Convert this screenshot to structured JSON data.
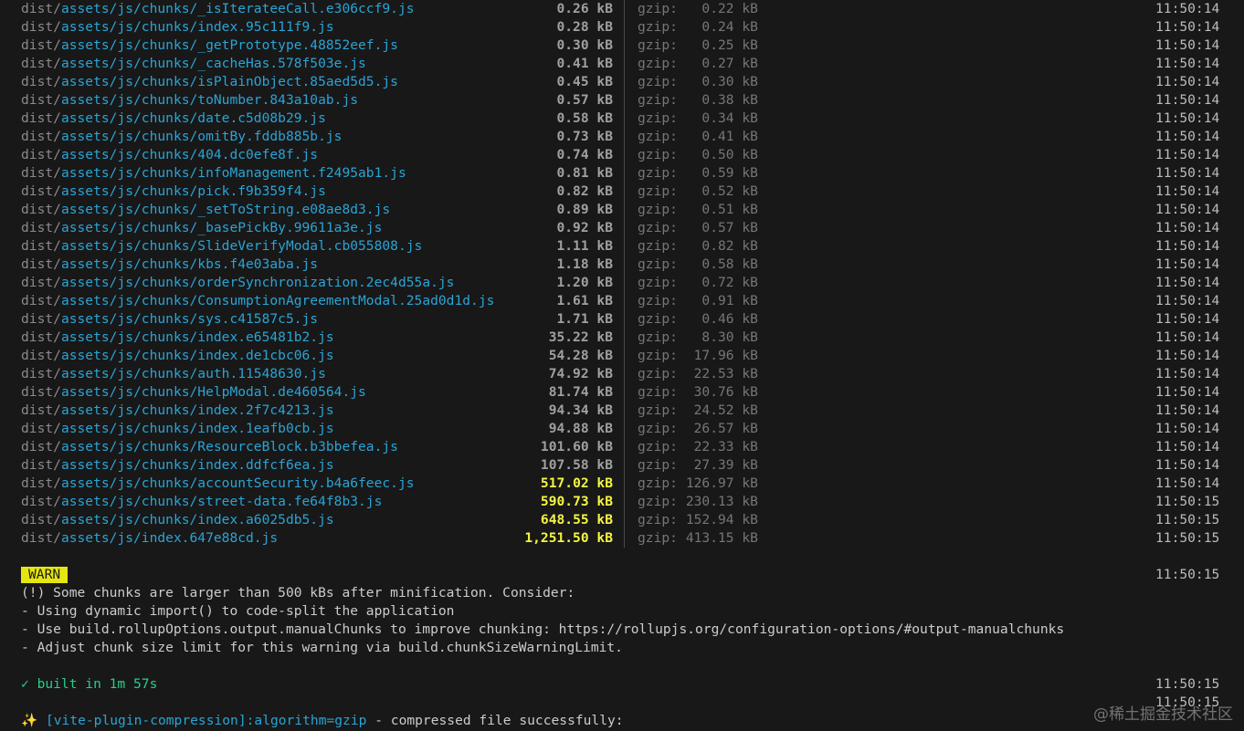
{
  "rows": [
    {
      "dir": "dist/",
      "file": "assets/js/chunks/_isIterateeCall.e306ccf9.js",
      "size": "0.26 kB",
      "gzip_label": "gzip:",
      "gzip": "0.22 kB",
      "time": "11:50:14",
      "large": false
    },
    {
      "dir": "dist/",
      "file": "assets/js/chunks/index.95c111f9.js",
      "size": "0.28 kB",
      "gzip_label": "gzip:",
      "gzip": "0.24 kB",
      "time": "11:50:14",
      "large": false
    },
    {
      "dir": "dist/",
      "file": "assets/js/chunks/_getPrototype.48852eef.js",
      "size": "0.30 kB",
      "gzip_label": "gzip:",
      "gzip": "0.25 kB",
      "time": "11:50:14",
      "large": false
    },
    {
      "dir": "dist/",
      "file": "assets/js/chunks/_cacheHas.578f503e.js",
      "size": "0.41 kB",
      "gzip_label": "gzip:",
      "gzip": "0.27 kB",
      "time": "11:50:14",
      "large": false
    },
    {
      "dir": "dist/",
      "file": "assets/js/chunks/isPlainObject.85aed5d5.js",
      "size": "0.45 kB",
      "gzip_label": "gzip:",
      "gzip": "0.30 kB",
      "time": "11:50:14",
      "large": false
    },
    {
      "dir": "dist/",
      "file": "assets/js/chunks/toNumber.843a10ab.js",
      "size": "0.57 kB",
      "gzip_label": "gzip:",
      "gzip": "0.38 kB",
      "time": "11:50:14",
      "large": false
    },
    {
      "dir": "dist/",
      "file": "assets/js/chunks/date.c5d08b29.js",
      "size": "0.58 kB",
      "gzip_label": "gzip:",
      "gzip": "0.34 kB",
      "time": "11:50:14",
      "large": false
    },
    {
      "dir": "dist/",
      "file": "assets/js/chunks/omitBy.fddb885b.js",
      "size": "0.73 kB",
      "gzip_label": "gzip:",
      "gzip": "0.41 kB",
      "time": "11:50:14",
      "large": false
    },
    {
      "dir": "dist/",
      "file": "assets/js/chunks/404.dc0efe8f.js",
      "size": "0.74 kB",
      "gzip_label": "gzip:",
      "gzip": "0.50 kB",
      "time": "11:50:14",
      "large": false
    },
    {
      "dir": "dist/",
      "file": "assets/js/chunks/infoManagement.f2495ab1.js",
      "size": "0.81 kB",
      "gzip_label": "gzip:",
      "gzip": "0.59 kB",
      "time": "11:50:14",
      "large": false
    },
    {
      "dir": "dist/",
      "file": "assets/js/chunks/pick.f9b359f4.js",
      "size": "0.82 kB",
      "gzip_label": "gzip:",
      "gzip": "0.52 kB",
      "time": "11:50:14",
      "large": false
    },
    {
      "dir": "dist/",
      "file": "assets/js/chunks/_setToString.e08ae8d3.js",
      "size": "0.89 kB",
      "gzip_label": "gzip:",
      "gzip": "0.51 kB",
      "time": "11:50:14",
      "large": false
    },
    {
      "dir": "dist/",
      "file": "assets/js/chunks/_basePickBy.99611a3e.js",
      "size": "0.92 kB",
      "gzip_label": "gzip:",
      "gzip": "0.57 kB",
      "time": "11:50:14",
      "large": false
    },
    {
      "dir": "dist/",
      "file": "assets/js/chunks/SlideVerifyModal.cb055808.js",
      "size": "1.11 kB",
      "gzip_label": "gzip:",
      "gzip": "0.82 kB",
      "time": "11:50:14",
      "large": false
    },
    {
      "dir": "dist/",
      "file": "assets/js/chunks/kbs.f4e03aba.js",
      "size": "1.18 kB",
      "gzip_label": "gzip:",
      "gzip": "0.58 kB",
      "time": "11:50:14",
      "large": false
    },
    {
      "dir": "dist/",
      "file": "assets/js/chunks/orderSynchronization.2ec4d55a.js",
      "size": "1.20 kB",
      "gzip_label": "gzip:",
      "gzip": "0.72 kB",
      "time": "11:50:14",
      "large": false
    },
    {
      "dir": "dist/",
      "file": "assets/js/chunks/ConsumptionAgreementModal.25ad0d1d.js",
      "size": "1.61 kB",
      "gzip_label": "gzip:",
      "gzip": "0.91 kB",
      "time": "11:50:14",
      "large": false
    },
    {
      "dir": "dist/",
      "file": "assets/js/chunks/sys.c41587c5.js",
      "size": "1.71 kB",
      "gzip_label": "gzip:",
      "gzip": "0.46 kB",
      "time": "11:50:14",
      "large": false
    },
    {
      "dir": "dist/",
      "file": "assets/js/chunks/index.e65481b2.js",
      "size": "35.22 kB",
      "gzip_label": "gzip:",
      "gzip": "8.30 kB",
      "time": "11:50:14",
      "large": false
    },
    {
      "dir": "dist/",
      "file": "assets/js/chunks/index.de1cbc06.js",
      "size": "54.28 kB",
      "gzip_label": "gzip:",
      "gzip": "17.96 kB",
      "time": "11:50:14",
      "large": false
    },
    {
      "dir": "dist/",
      "file": "assets/js/chunks/auth.11548630.js",
      "size": "74.92 kB",
      "gzip_label": "gzip:",
      "gzip": "22.53 kB",
      "time": "11:50:14",
      "large": false
    },
    {
      "dir": "dist/",
      "file": "assets/js/chunks/HelpModal.de460564.js",
      "size": "81.74 kB",
      "gzip_label": "gzip:",
      "gzip": "30.76 kB",
      "time": "11:50:14",
      "large": false
    },
    {
      "dir": "dist/",
      "file": "assets/js/chunks/index.2f7c4213.js",
      "size": "94.34 kB",
      "gzip_label": "gzip:",
      "gzip": "24.52 kB",
      "time": "11:50:14",
      "large": false
    },
    {
      "dir": "dist/",
      "file": "assets/js/chunks/index.1eafb0cb.js",
      "size": "94.88 kB",
      "gzip_label": "gzip:",
      "gzip": "26.57 kB",
      "time": "11:50:14",
      "large": false
    },
    {
      "dir": "dist/",
      "file": "assets/js/chunks/ResourceBlock.b3bbefea.js",
      "size": "101.60 kB",
      "gzip_label": "gzip:",
      "gzip": "22.33 kB",
      "time": "11:50:14",
      "large": false
    },
    {
      "dir": "dist/",
      "file": "assets/js/chunks/index.ddfcf6ea.js",
      "size": "107.58 kB",
      "gzip_label": "gzip:",
      "gzip": "27.39 kB",
      "time": "11:50:14",
      "large": false
    },
    {
      "dir": "dist/",
      "file": "assets/js/chunks/accountSecurity.b4a6feec.js",
      "size": "517.02 kB",
      "gzip_label": "gzip:",
      "gzip": "126.97 kB",
      "time": "11:50:14",
      "large": true
    },
    {
      "dir": "dist/",
      "file": "assets/js/chunks/street-data.fe64f8b3.js",
      "size": "590.73 kB",
      "gzip_label": "gzip:",
      "gzip": "230.13 kB",
      "time": "11:50:15",
      "large": true
    },
    {
      "dir": "dist/",
      "file": "assets/js/chunks/index.a6025db5.js",
      "size": "648.55 kB",
      "gzip_label": "gzip:",
      "gzip": "152.94 kB",
      "time": "11:50:15",
      "large": true
    },
    {
      "dir": "dist/",
      "file": "assets/js/index.647e88cd.js",
      "size": "1,251.50 kB",
      "gzip_label": "gzip:",
      "gzip": "413.15 kB",
      "time": "11:50:15",
      "large": true
    }
  ],
  "warn": {
    "badge": "WARN",
    "time": "11:50:15",
    "lines": [
      "(!) Some chunks are larger than 500 kBs after minification. Consider:",
      "- Using dynamic import() to code-split the application",
      "- Use build.rollupOptions.output.manualChunks to improve chunking: https://rollupjs.org/configuration-options/#output-manualchunks",
      "- Adjust chunk size limit for this warning via build.chunkSizeWarningLimit."
    ]
  },
  "built": {
    "text": "✓ built in 1m 57s",
    "time": "11:50:15",
    "time2": "11:50:15"
  },
  "compression": {
    "sparkle": "✨",
    "plugin": "[vite-plugin-compression]:algorithm=gzip",
    "message": " - compressed file successfully:"
  },
  "watermark": "@稀土掘金技术社区",
  "colors": {
    "background": "#181818",
    "filename": "#2aa4d6",
    "warn_badge": "#e5e510",
    "large_size": "#f5f543",
    "success": "#23d18b"
  }
}
